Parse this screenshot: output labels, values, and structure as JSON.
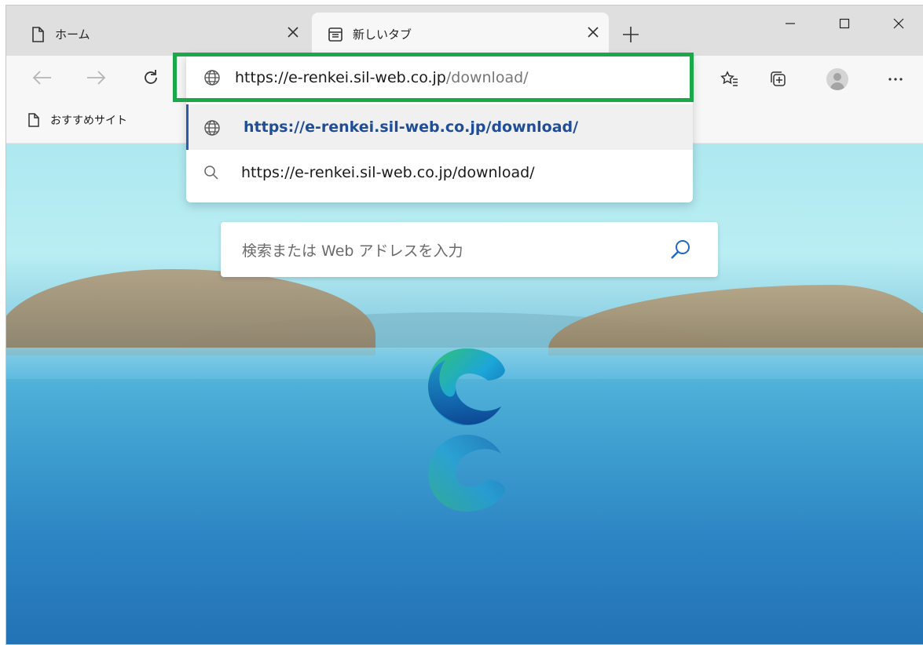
{
  "tabs": [
    {
      "label": "ホーム",
      "active": false
    },
    {
      "label": "新しいタブ",
      "active": true
    }
  ],
  "favorites": {
    "items": [
      {
        "label": "おすすめサイト"
      }
    ]
  },
  "address_bar": {
    "url_host": "https://e-renkei.sil-web.co.jp",
    "url_path": "/download/"
  },
  "suggestions": [
    {
      "text": "https://e-renkei.sil-web.co.jp/download/",
      "icon": "globe-icon",
      "selected": true
    },
    {
      "text": "https://e-renkei.sil-web.co.jp/download/",
      "icon": "search-icon",
      "selected": false
    }
  ],
  "new_tab_page": {
    "search_placeholder": "検索または Web アドレスを入力"
  },
  "colors": {
    "highlight": "#1aa84a",
    "selected_text": "#1f4e96"
  }
}
